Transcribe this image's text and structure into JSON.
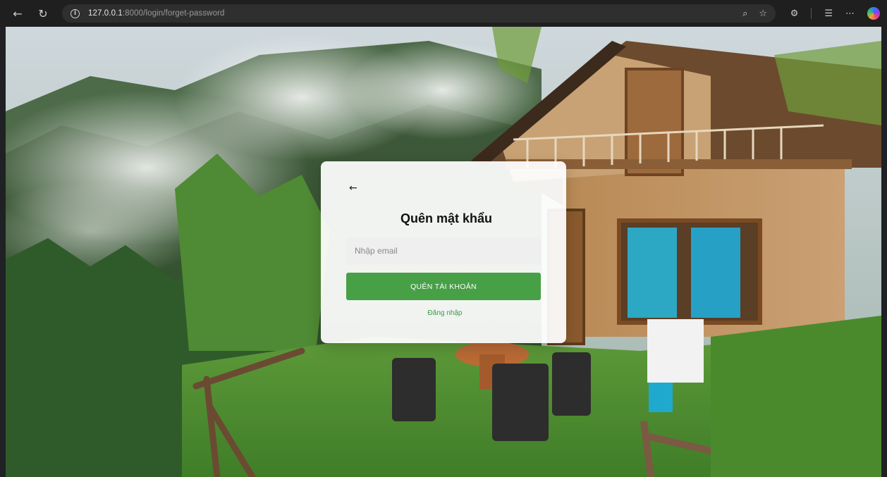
{
  "browser": {
    "url_host": "127.0.0.1",
    "url_rest": ":8000/login/forget-password"
  },
  "colors": {
    "accent_green": "#47a046",
    "link_green": "#3b9a44"
  },
  "form": {
    "back_arrow": "←",
    "title": "Quên mật khẩu",
    "email_placeholder": "Nhập email",
    "submit_label": "QUÊN TÀI KHOẢN",
    "login_link": "Đăng nhập"
  }
}
